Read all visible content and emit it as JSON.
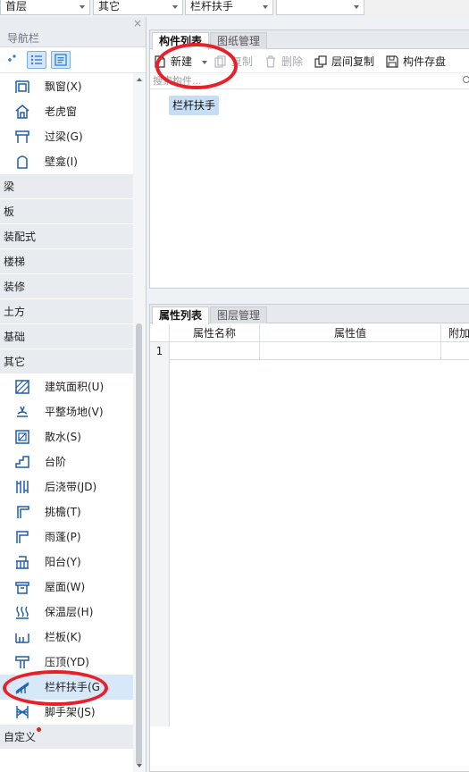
{
  "topbar": {
    "dropdowns": [
      {
        "value": "首层"
      },
      {
        "value": "其它"
      },
      {
        "value": "栏杆扶手"
      },
      {
        "value": ""
      }
    ]
  },
  "nav": {
    "title": "导航栏",
    "close": "×",
    "items_top": [
      {
        "label": "飘窗(X)",
        "icon": "bay-window-icon"
      },
      {
        "label": "老虎窗",
        "icon": "dormer-window-icon"
      },
      {
        "label": "过梁(G)",
        "icon": "lintel-icon"
      },
      {
        "label": "壁龛(I)",
        "icon": "niche-icon"
      }
    ],
    "categories": [
      "梁",
      "板",
      "装配式",
      "楼梯",
      "装修",
      "土方",
      "基础",
      "其它"
    ],
    "items_other": [
      {
        "label": "建筑面积(U)",
        "icon": "building-area-icon"
      },
      {
        "label": "平整场地(V)",
        "icon": "site-leveling-icon"
      },
      {
        "label": "散水(S)",
        "icon": "apron-icon"
      },
      {
        "label": "台阶",
        "icon": "steps-icon"
      },
      {
        "label": "后浇带(JD)",
        "icon": "post-pour-strip-icon"
      },
      {
        "label": "挑檐(T)",
        "icon": "eave-icon"
      },
      {
        "label": "雨蓬(P)",
        "icon": "canopy-icon"
      },
      {
        "label": "阳台(Y)",
        "icon": "balcony-icon"
      },
      {
        "label": "屋面(W)",
        "icon": "roof-icon"
      },
      {
        "label": "保温层(H)",
        "icon": "insulation-icon"
      },
      {
        "label": "栏板(K)",
        "icon": "parapet-panel-icon"
      },
      {
        "label": "压顶(YD)",
        "icon": "coping-icon"
      },
      {
        "label": "栏杆扶手(G",
        "icon": "railing-icon"
      },
      {
        "label": "脚手架(JS)",
        "icon": "scaffold-icon"
      }
    ],
    "custom_category": "自定义"
  },
  "component_panel": {
    "tabs": [
      {
        "label": "构件列表"
      },
      {
        "label": "图纸管理"
      }
    ],
    "toolbar": {
      "new": "新建",
      "copy": "复制",
      "delete": "删除",
      "floor_copy": "层间复制",
      "save": "构件存盘"
    },
    "search_placeholder": "搜索构件...",
    "components": [
      "栏杆扶手"
    ]
  },
  "property_panel": {
    "tabs": [
      {
        "label": "属性列表"
      },
      {
        "label": "图层管理"
      }
    ],
    "columns": [
      "属性名称",
      "属性值",
      "附加"
    ],
    "rows": [
      {
        "index": "1",
        "name": "",
        "value": "",
        "extra": ""
      }
    ]
  },
  "colors": {
    "selection": "#d7e8f8",
    "category_bg": "#e8ecf0",
    "annotation_red": "#e8202a"
  }
}
